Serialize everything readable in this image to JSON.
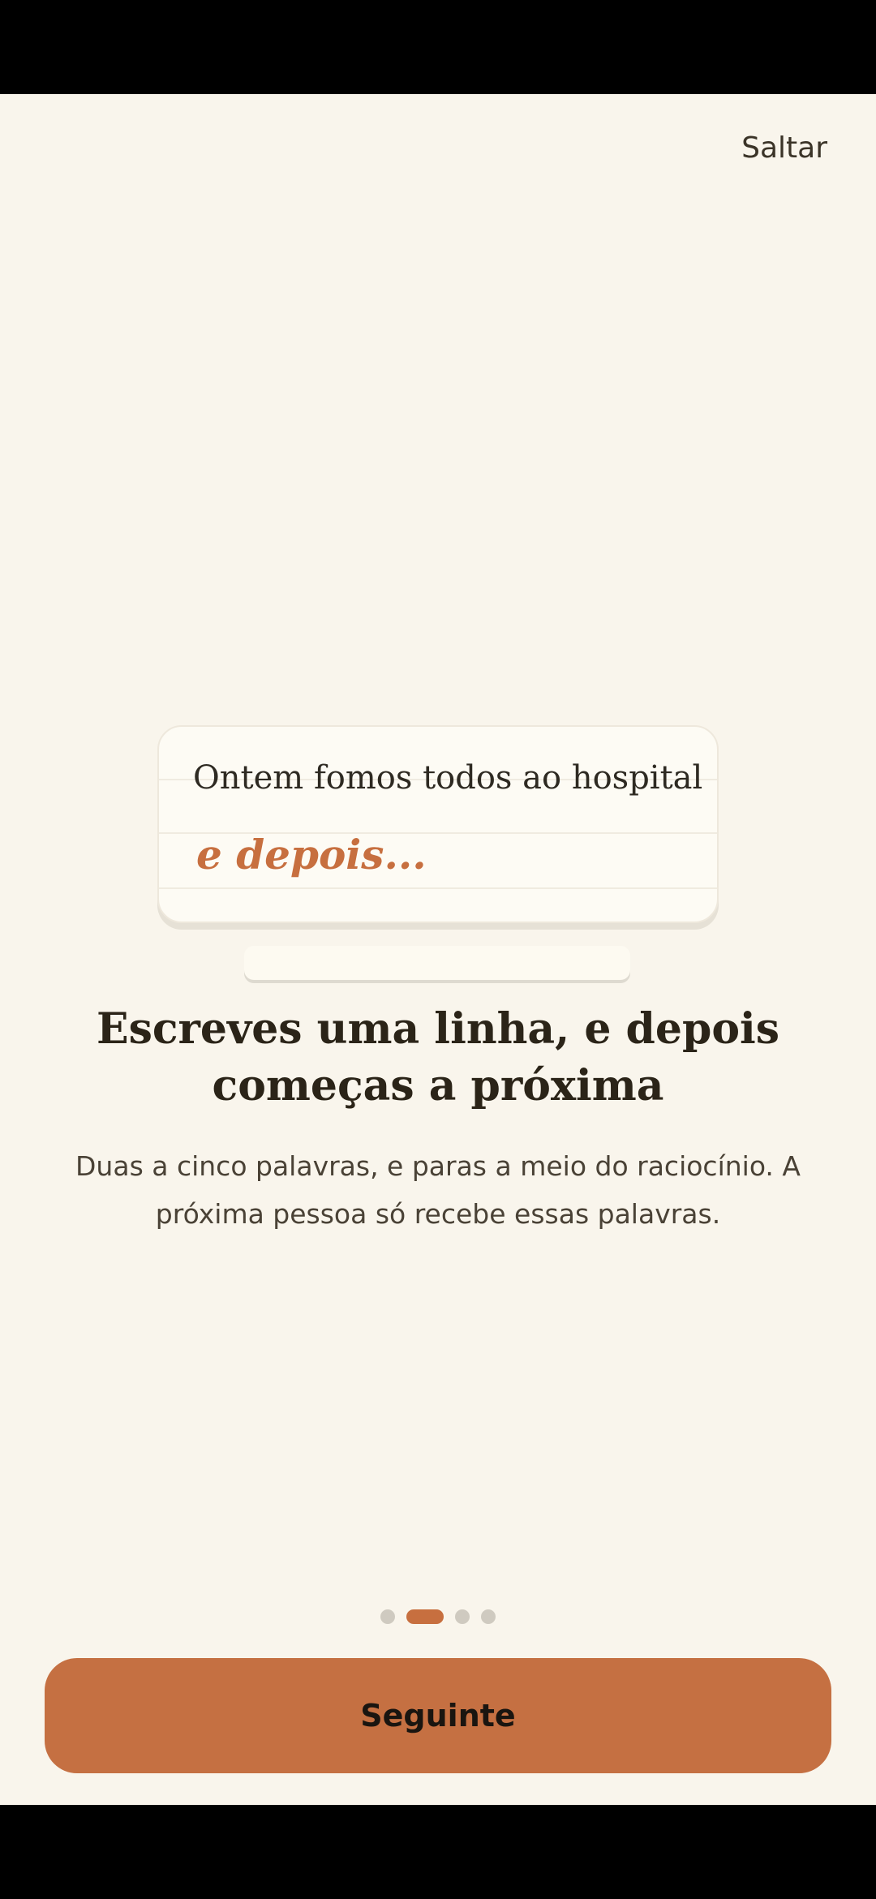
{
  "header": {
    "skip_label": "Saltar"
  },
  "illustration": {
    "card_line_1": "Ontem fomos todos ao hospital",
    "card_line_2": "e depois..."
  },
  "content": {
    "headline_line_1": "Escreves uma linha, e depois",
    "headline_line_2": "começas a próxima",
    "body_line_1": "Duas a cinco palavras, e paras a meio do raciocínio. A",
    "body_line_2": "próxima pessoa só recebe essas palavras."
  },
  "pager": {
    "total": 4,
    "current": 2
  },
  "footer": {
    "next_label": "Seguinte"
  },
  "colors": {
    "background": "#F9F5EC",
    "accent": "#C57042",
    "text_dark": "#2B2418"
  }
}
